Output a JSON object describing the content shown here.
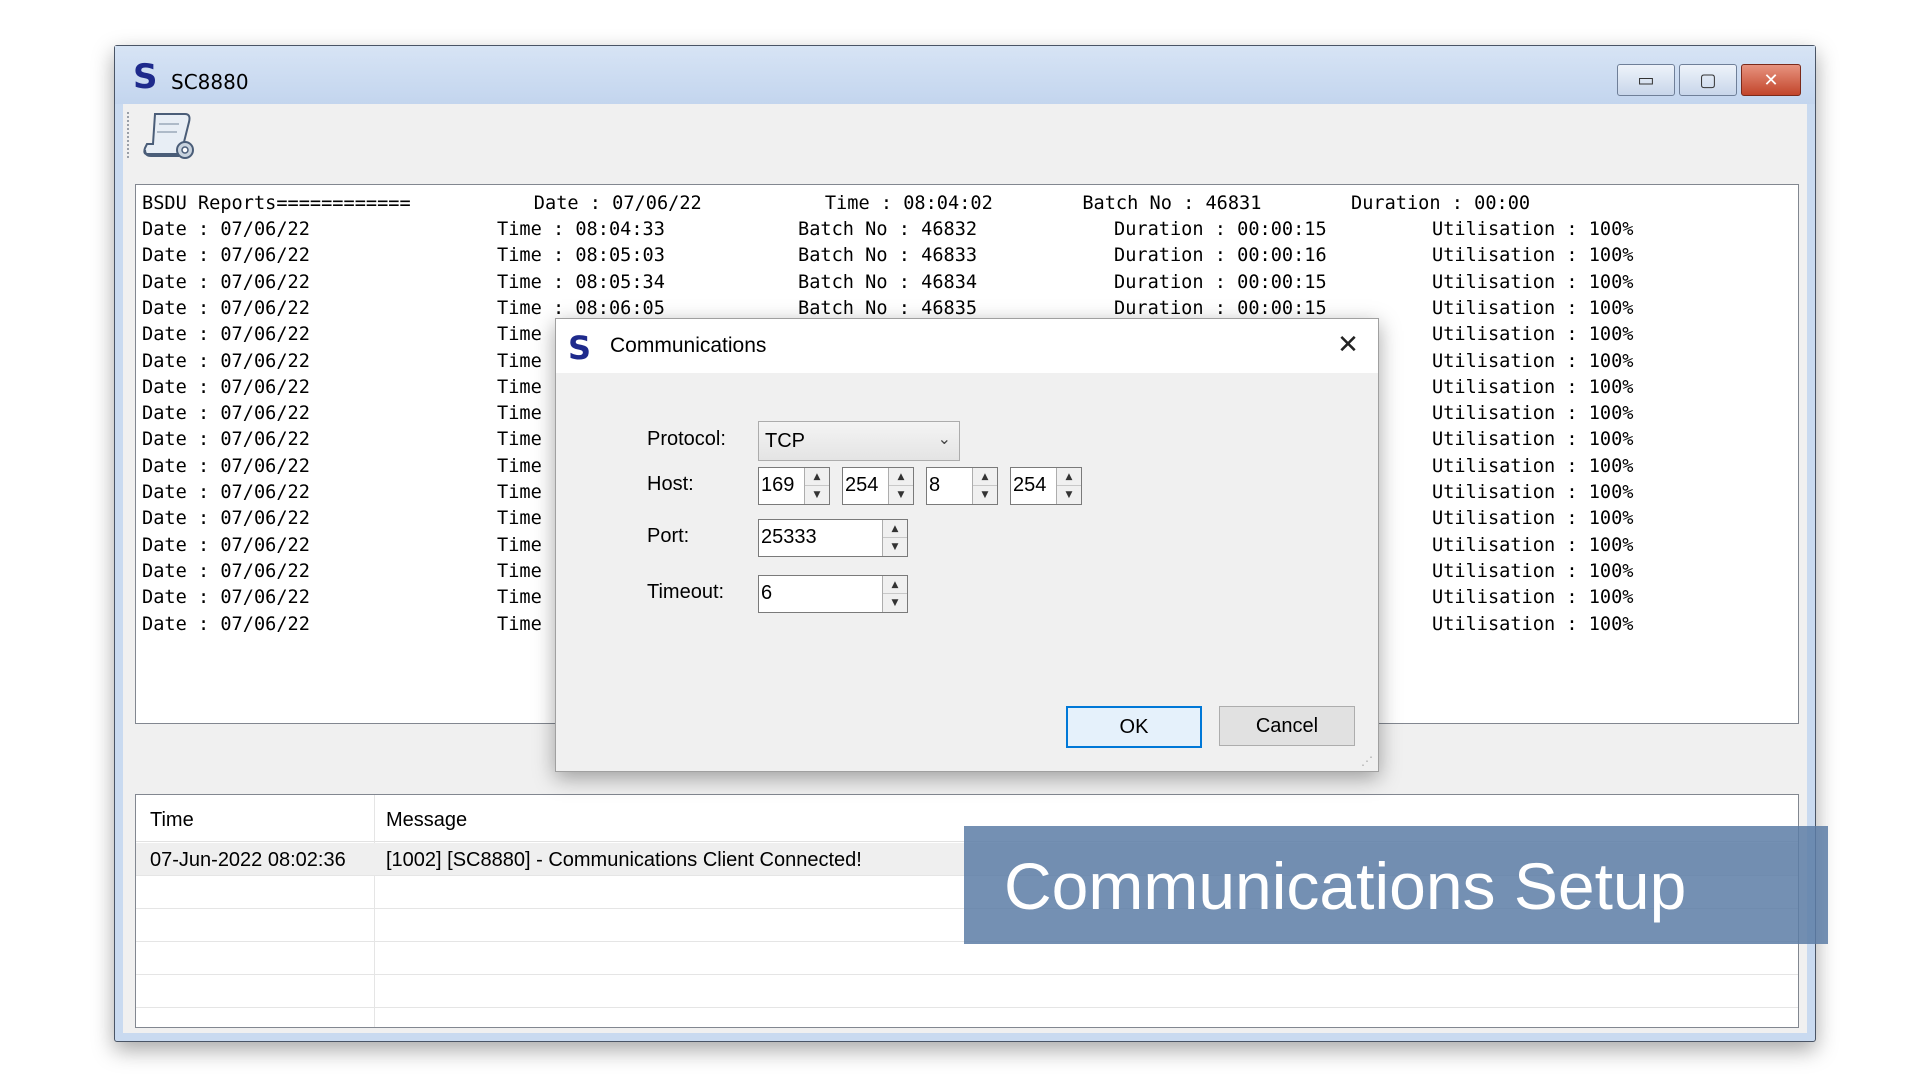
{
  "app": {
    "logo_glyph": "S",
    "title": "SC8880",
    "controls": {
      "minimize": "▭",
      "maximize": "▢",
      "close": "✕"
    }
  },
  "toolbar": {
    "report_icon": "report-settings-icon"
  },
  "report": {
    "header": "BSDU Reports============           Date : 07/06/22           Time : 08:04:02        Batch No : 46831        Duration : 00:00",
    "rows": [
      {
        "date": "Date : 07/06/22",
        "time": "Time : 08:04:33",
        "batch": "Batch No : 46832",
        "duration": "Duration : 00:00:15",
        "util": "Utilisation : 100%"
      },
      {
        "date": "Date : 07/06/22",
        "time": "Time : 08:05:03",
        "batch": "Batch No : 46833",
        "duration": "Duration : 00:00:16",
        "util": "Utilisation : 100%"
      },
      {
        "date": "Date : 07/06/22",
        "time": "Time : 08:05:34",
        "batch": "Batch No : 46834",
        "duration": "Duration : 00:00:15",
        "util": "Utilisation : 100%"
      },
      {
        "date": "Date : 07/06/22",
        "time": "Time : 08:06:05",
        "batch": "Batch No : 46835",
        "duration": "Duration : 00:00:15",
        "util": "Utilisation : 100%"
      },
      {
        "date": "Date : 07/06/22",
        "time": "Time",
        "batch": "",
        "duration": "",
        "util": "Utilisation : 100%"
      },
      {
        "date": "Date : 07/06/22",
        "time": "Time",
        "batch": "",
        "duration": "",
        "util": "Utilisation : 100%"
      },
      {
        "date": "Date : 07/06/22",
        "time": "Time",
        "batch": "",
        "duration": "",
        "util": "Utilisation : 100%"
      },
      {
        "date": "Date : 07/06/22",
        "time": "Time",
        "batch": "",
        "duration": "",
        "util": "Utilisation : 100%"
      },
      {
        "date": "Date : 07/06/22",
        "time": "Time",
        "batch": "",
        "duration": "",
        "util": "Utilisation : 100%"
      },
      {
        "date": "Date : 07/06/22",
        "time": "Time",
        "batch": "",
        "duration": "",
        "util": "Utilisation : 100%"
      },
      {
        "date": "Date : 07/06/22",
        "time": "Time",
        "batch": "",
        "duration": "",
        "util": "Utilisation : 100%"
      },
      {
        "date": "Date : 07/06/22",
        "time": "Time",
        "batch": "",
        "duration": "",
        "util": "Utilisation : 100%"
      },
      {
        "date": "Date : 07/06/22",
        "time": "Time",
        "batch": "",
        "duration": "",
        "util": "Utilisation : 100%"
      },
      {
        "date": "Date : 07/06/22",
        "time": "Time",
        "batch": "",
        "duration": "",
        "util": "Utilisation : 100%"
      },
      {
        "date": "Date : 07/06/22",
        "time": "Time",
        "batch": "",
        "duration": "",
        "util": "Utilisation : 100%"
      },
      {
        "date": "Date : 07/06/22",
        "time": "Time",
        "batch": "",
        "duration": "",
        "util": "Utilisation : 100%"
      }
    ]
  },
  "log": {
    "columns": [
      "Time",
      "Message"
    ],
    "rows": [
      {
        "time": "07-Jun-2022 08:02:36",
        "message": "[1002] [SC8880] - Communications Client Connected!"
      }
    ]
  },
  "dialog": {
    "logo_glyph": "S",
    "title": "Communications",
    "close": "✕",
    "protocol_label": "Protocol:",
    "protocol_value": "TCP",
    "host_label": "Host:",
    "host_octets": [
      "169",
      "254",
      "8",
      "254"
    ],
    "port_label": "Port:",
    "port_value": "25333",
    "timeout_label": "Timeout:",
    "timeout_value": "6",
    "ok_label": "OK",
    "cancel_label": "Cancel"
  },
  "overlay": {
    "caption": "Communications Setup"
  }
}
